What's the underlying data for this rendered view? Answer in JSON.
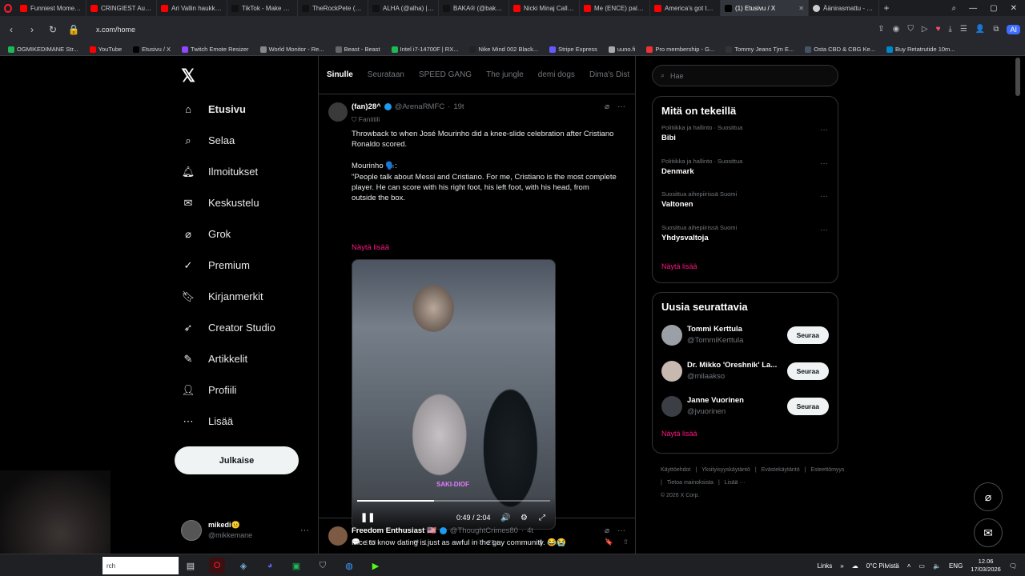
{
  "browser": {
    "tabs": [
      {
        "label": "Funniest Moments",
        "icon": "youtube-icon",
        "color": "#ff0000"
      },
      {
        "label": "CRINGIEST Audition",
        "icon": "youtube-icon",
        "color": "#ff0000"
      },
      {
        "label": "Ari Vallin haukkui st",
        "icon": "youtube-icon",
        "color": "#ff0000"
      },
      {
        "label": "TikTok - Make Your",
        "icon": "tiktok-icon",
        "color": "#111111"
      },
      {
        "label": "TheRockPete (@the",
        "icon": "tiktok-icon",
        "color": "#111111"
      },
      {
        "label": "ALHA (@alha) | Tik",
        "icon": "tiktok-icon",
        "color": "#111111"
      },
      {
        "label": "BAKA® (@bakaflo",
        "icon": "tiktok-icon",
        "color": "#111111"
      },
      {
        "label": "Nicki Minaj Calls K",
        "icon": "youtube-icon",
        "color": "#ff0000"
      },
      {
        "label": "Me (ENCE) palattin",
        "icon": "youtube-icon",
        "color": "#ff0000"
      },
      {
        "label": "America's got talen",
        "icon": "youtube-icon",
        "color": "#ff0000"
      },
      {
        "label": "(1) Etusivu / X",
        "icon": "x-icon",
        "color": "#000000",
        "active": true
      },
      {
        "label": "Äänirasmattu - Tuli",
        "icon": "globe-icon",
        "color": "#cccccc"
      }
    ],
    "url": "x.com/home",
    "ai_label": "AI",
    "bookmarks": [
      "OGMIKEDIMANE Str...",
      "YouTube",
      "Etusivu / X",
      "Twitch Emote Resizer",
      "World Monitor - Re...",
      "Beast - Beast",
      "Intel i7-14700F | RX...",
      "Nike Mind 002 Black...",
      "Stripe Express",
      "uuno.fi",
      "Pro membership - G...",
      "Tommy Jeans Tjm E...",
      "Osta CBD & CBG Ke...",
      "Buy Retatrutide 10m..."
    ]
  },
  "nav": {
    "items": [
      {
        "label": "Etusivu",
        "icon": "home-icon",
        "active": true
      },
      {
        "label": "Selaa",
        "icon": "search-icon"
      },
      {
        "label": "Ilmoitukset",
        "icon": "bell-icon"
      },
      {
        "label": "Keskustelu",
        "icon": "mail-icon"
      },
      {
        "label": "Grok",
        "icon": "grok-icon"
      },
      {
        "label": "Premium",
        "icon": "verified-icon"
      },
      {
        "label": "Kirjanmerkit",
        "icon": "bookmark-icon"
      },
      {
        "label": "Creator Studio",
        "icon": "rocket-icon"
      },
      {
        "label": "Artikkelit",
        "icon": "article-icon"
      },
      {
        "label": "Profiili",
        "icon": "profile-icon"
      },
      {
        "label": "Lisää",
        "icon": "more-icon"
      }
    ],
    "post_button": "Julkaise",
    "account": {
      "name": "mikedi😐",
      "handle": "@mikkemane"
    }
  },
  "timeline": {
    "tabs": [
      "Sinulle",
      "Seurataan",
      "SPEED GANG",
      "The jungle",
      "demi dogs",
      "Dima's Dist"
    ],
    "tweets": [
      {
        "name": "(fan)28^",
        "handle": "@ArenaRMFC",
        "time": "19t",
        "badge": "Faniitili",
        "text_lines": [
          "Throwback to when José Mourinho did a knee-slide celebration after Cristiano",
          "Ronaldo scored.",
          "",
          "Mourinho 🗣️:",
          "\"People talk about Messi and Cristiano. For me, Cristiano is the most complete",
          "player. He can score with his right foot, his left foot, with his head, from",
          "outside the box."
        ],
        "show_more": "Näytä lisää",
        "video": {
          "caption": "SAKI-DIOF",
          "time": "0:49 / 2:04",
          "progress": 0.4
        },
        "stats": {
          "replies": "168",
          "reposts": "1 t.",
          "likes": "25 t.",
          "views": "1 milj."
        }
      },
      {
        "name": "Freedom Enthusiast 🇺🇸",
        "handle": "@ThoughtCrimes80",
        "time": "4t",
        "text": "Nice to know dating is just as awful in the gay community. 😂😭"
      }
    ]
  },
  "right": {
    "search_placeholder": "Hae",
    "trends_title": "Mitä on tekeillä",
    "trends": [
      {
        "meta": "Politiikka ja hallinto · Suosittua",
        "name": "Bibi"
      },
      {
        "meta": "Politiikka ja hallinto · Suosittua",
        "name": "Denmark"
      },
      {
        "meta": "Suosittua aihepiirissä Suomi",
        "name": "Valtonen"
      },
      {
        "meta": "Suosittua aihepiirissä Suomi",
        "name": "Yhdysvaltoja"
      }
    ],
    "trends_more": "Näytä lisää",
    "follow_title": "Uusia seurattavia",
    "follows": [
      {
        "name": "Tommi Kerttula",
        "handle": "@TommiKerttula",
        "button": "Seuraa"
      },
      {
        "name": "Dr. Mikko 'Oreshnik' La...",
        "handle": "@milaakso",
        "button": "Seuraa"
      },
      {
        "name": "Janne Vuorinen",
        "handle": "@jvuorinen",
        "button": "Seuraa"
      }
    ],
    "follow_more": "Näytä lisää",
    "footer": [
      "Käyttöehdot",
      "|",
      "Yksityisyyskäytäntö",
      "|",
      "Evästekäytäntö",
      "|",
      "Esteettömyys",
      "|",
      "Tietoa mainoksista",
      "|",
      "Lisää ···",
      "© 2026 X Corp."
    ]
  },
  "taskbar": {
    "search": "rch",
    "links": "Links",
    "weather": "0°C  Pilvistä",
    "lang": "ENG",
    "time": "12.06",
    "date": "17/03/2026"
  }
}
